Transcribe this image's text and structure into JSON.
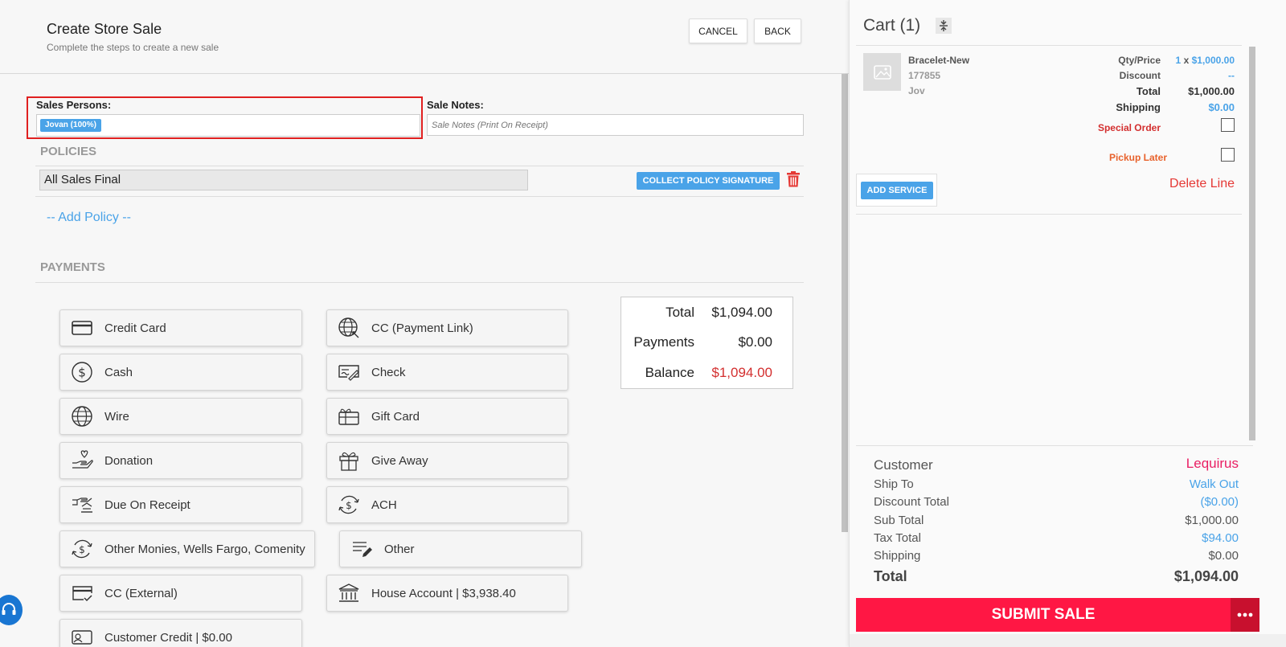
{
  "colors": {
    "accent_blue": "#4aa3e8",
    "danger_red": "#e53935",
    "submit_red": "#ff1744",
    "highlight_border": "#e02020",
    "customer_name": "#e91e63"
  },
  "header": {
    "title": "Create Store Sale",
    "subtitle": "Complete the steps to create a new sale",
    "cancel_label": "CANCEL",
    "back_label": "BACK"
  },
  "form": {
    "sales_persons_label": "Sales Persons:",
    "sales_person_chip": "Jovan (100%)",
    "sale_notes_label": "Sale Notes:",
    "sale_notes_placeholder": "Sale Notes (Print On Receipt)",
    "sale_notes_value": ""
  },
  "policies": {
    "title": "POLICIES",
    "items": [
      {
        "label": "All Sales Final"
      }
    ],
    "collect_signature_label": "COLLECT POLICY SIGNATURE",
    "add_policy_label": "-- Add Policy --",
    "delete_icon": "trash-icon"
  },
  "payments": {
    "title": "PAYMENTS",
    "methods": [
      {
        "label": "Credit Card",
        "icon": "credit-card-icon"
      },
      {
        "label": "CC (Payment Link)",
        "icon": "globe-link-icon"
      },
      {
        "label": "Cash",
        "icon": "dollar-coin-icon"
      },
      {
        "label": "Check",
        "icon": "check-icon"
      },
      {
        "label": "Wire",
        "icon": "globe-icon"
      },
      {
        "label": "Gift Card",
        "icon": "gift-card-icon"
      },
      {
        "label": "Donation",
        "icon": "donation-hand-icon"
      },
      {
        "label": "Give Away",
        "icon": "gift-box-icon"
      },
      {
        "label": "Due On Receipt",
        "icon": "hand-receipt-icon"
      },
      {
        "label": "ACH",
        "icon": "ach-exchange-icon"
      },
      {
        "label": "Other Monies, Wells Fargo, Comenity",
        "icon": "money-exchange-icon"
      },
      {
        "label": "Other",
        "icon": "list-pencil-icon"
      },
      {
        "label": "CC (External)",
        "icon": "card-check-icon"
      },
      {
        "label": "House Account | $3,938.40",
        "icon": "bank-icon"
      },
      {
        "label": "Customer Credit | $0.00",
        "icon": "customer-credit-icon"
      }
    ],
    "summary": {
      "total_label": "Total",
      "total_value": "$1,094.00",
      "payments_label": "Payments",
      "payments_value": "$0.00",
      "balance_label": "Balance",
      "balance_value": "$1,094.00"
    }
  },
  "cart": {
    "title": "Cart (1)",
    "item": {
      "name": "Bracelet-New",
      "sku": "177855",
      "salesperson": "Jov",
      "qty_price_label": "Qty/Price",
      "qty": "1",
      "qty_x": "x",
      "price": "$1,000.00",
      "discount_label": "Discount",
      "discount_value": "--",
      "total_label": "Total",
      "total_value": "$1,000.00",
      "shipping_label": "Shipping",
      "shipping_value": "$0.00",
      "special_order_label": "Special Order",
      "special_order_checked": false,
      "pickup_later_label": "Pickup Later",
      "pickup_later_checked": false,
      "add_service_label": "ADD SERVICE",
      "delete_line_label": "Delete Line"
    },
    "summary": {
      "customer_label": "Customer",
      "customer_value": "Lequirus",
      "ship_to_label": "Ship To",
      "ship_to_value": "Walk Out",
      "discount_total_label": "Discount Total",
      "discount_total_value": "($0.00)",
      "sub_total_label": "Sub Total",
      "sub_total_value": "$1,000.00",
      "tax_total_label": "Tax Total",
      "tax_total_value": "$94.00",
      "shipping_label": "Shipping",
      "shipping_value": "$0.00",
      "total_label": "Total",
      "total_value": "$1,094.00"
    },
    "submit_label": "SUBMIT SALE"
  }
}
